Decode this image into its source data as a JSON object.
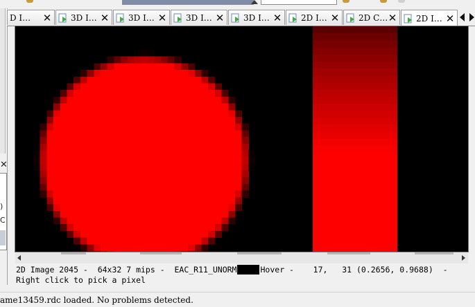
{
  "tabs": [
    {
      "label": "D I…",
      "icon": "texture-viewer-icon"
    },
    {
      "label": "3D I…",
      "icon": "texture-viewer-icon"
    },
    {
      "label": "3D I…",
      "icon": "texture-viewer-icon"
    },
    {
      "label": "3D I…",
      "icon": "texture-viewer-icon"
    },
    {
      "label": "3D I…",
      "icon": "texture-viewer-icon"
    },
    {
      "label": "2D I…",
      "icon": "texture-viewer-icon"
    },
    {
      "label": "2D C…",
      "icon": "texture-viewer-icon"
    },
    {
      "label": "2D I…",
      "icon": "texture-viewer-icon"
    }
  ],
  "active_tab_index": 7,
  "close_glyph": "✕",
  "texture": {
    "background_color": "#000000",
    "circle_color": "#ff0000",
    "bar_top_color": "#5a0000",
    "bar_bottom_color": "#ff0000"
  },
  "status": {
    "image_info": "2D Image 2045 -  64x32 7 mips -  EAC_R11_UNORM",
    "swatch_color": "#000000",
    "hover_info": "Hover -    17,   31 (0.2656, 0.9688)  -",
    "hint": "Right click to pick a pixel"
  },
  "app_status": {
    "message": "ame13459.rdc loaded. No problems detected."
  },
  "left_dock": {
    "close_glyph": "✕",
    "fragment_1": ")",
    "fragment_2": "C"
  }
}
